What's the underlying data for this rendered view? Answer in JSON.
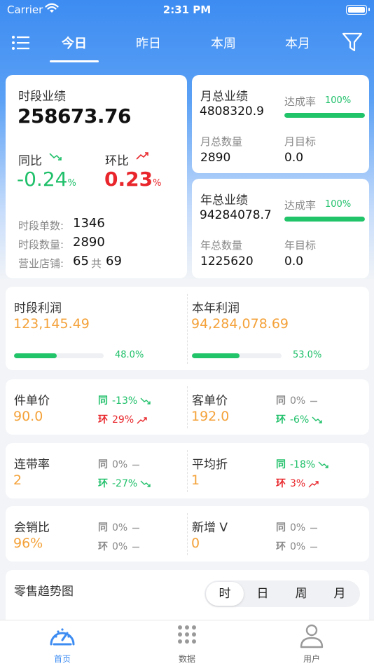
{
  "status_bar": {
    "carrier": "Carrier",
    "time": "2:31 PM"
  },
  "nav": {
    "tabs": [
      "今日",
      "昨日",
      "本周",
      "本月"
    ],
    "active_tab": 0
  },
  "period_card": {
    "title": "时段业绩",
    "value": "258673.76",
    "yoy_label": "同比",
    "yoy_value": "-0.24",
    "mom_label": "环比",
    "mom_value": "0.23",
    "percent_sign": "%",
    "orders_label": "时段单数:",
    "orders_value": "1346",
    "qty_label": "时段数量:",
    "qty_value": "2890",
    "stores_label": "营业店铺:",
    "stores_open": "65",
    "stores_sep": "共",
    "stores_total": "69"
  },
  "month_card": {
    "title": "月总业绩",
    "value": "4808320.9",
    "rate_label": "达成率",
    "rate_value": "100%",
    "rate_fraction": 1.0,
    "qty_label": "月总数量",
    "qty_value": "2890",
    "target_label": "月目标",
    "target_value": "0.0"
  },
  "year_card": {
    "title": "年总业绩",
    "value": "94284078.7",
    "rate_label": "达成率",
    "rate_value": "100%",
    "rate_fraction": 1.0,
    "qty_label": "年总数量",
    "qty_value": "1225620",
    "target_label": "年目标",
    "target_value": "0.0"
  },
  "profit_card": {
    "left": {
      "title": "时段利润",
      "value": "123,145.49",
      "pct": "48.0%",
      "fraction": 0.48
    },
    "right": {
      "title": "本年利润",
      "value": "94,284,078.69",
      "pct": "53.0%",
      "fraction": 0.53
    }
  },
  "metrics": [
    {
      "left": {
        "title": "件单价",
        "value": "90.0",
        "yoy_k": "同",
        "yoy_v": "-13%",
        "yoy_dir": "down",
        "mom_k": "环",
        "mom_v": "29%",
        "mom_dir": "up"
      },
      "right": {
        "title": "客单价",
        "value": "192.0",
        "yoy_k": "同",
        "yoy_v": "0%",
        "yoy_dir": "flat",
        "mom_k": "环",
        "mom_v": "-6%",
        "mom_dir": "down"
      }
    },
    {
      "left": {
        "title": "连带率",
        "value": "2",
        "yoy_k": "同",
        "yoy_v": "0%",
        "yoy_dir": "flat",
        "mom_k": "环",
        "mom_v": "-27%",
        "mom_dir": "down"
      },
      "right": {
        "title": "平均折",
        "value": "1",
        "yoy_k": "同",
        "yoy_v": "-18%",
        "yoy_dir": "down",
        "mom_k": "环",
        "mom_v": "3%",
        "mom_dir": "up"
      }
    },
    {
      "left": {
        "title": "会销比",
        "value": "96%",
        "yoy_k": "同",
        "yoy_v": "0%",
        "yoy_dir": "flat",
        "mom_k": "环",
        "mom_v": "0%",
        "mom_dir": "flat"
      },
      "right": {
        "title": "新增 V",
        "value": "0",
        "yoy_k": "同",
        "yoy_v": "0%",
        "yoy_dir": "flat",
        "mom_k": "环",
        "mom_v": "0%",
        "mom_dir": "flat"
      }
    }
  ],
  "trend": {
    "title": "零售趋势图",
    "options": [
      "时",
      "日",
      "周",
      "月"
    ],
    "active": 0
  },
  "tabbar": {
    "items": [
      "首页",
      "数据",
      "用户"
    ],
    "active": 0
  },
  "colors": {
    "primary": "#3d8cf2",
    "green": "#20c06a",
    "red": "#e8262b",
    "orange": "#f4a23a"
  }
}
